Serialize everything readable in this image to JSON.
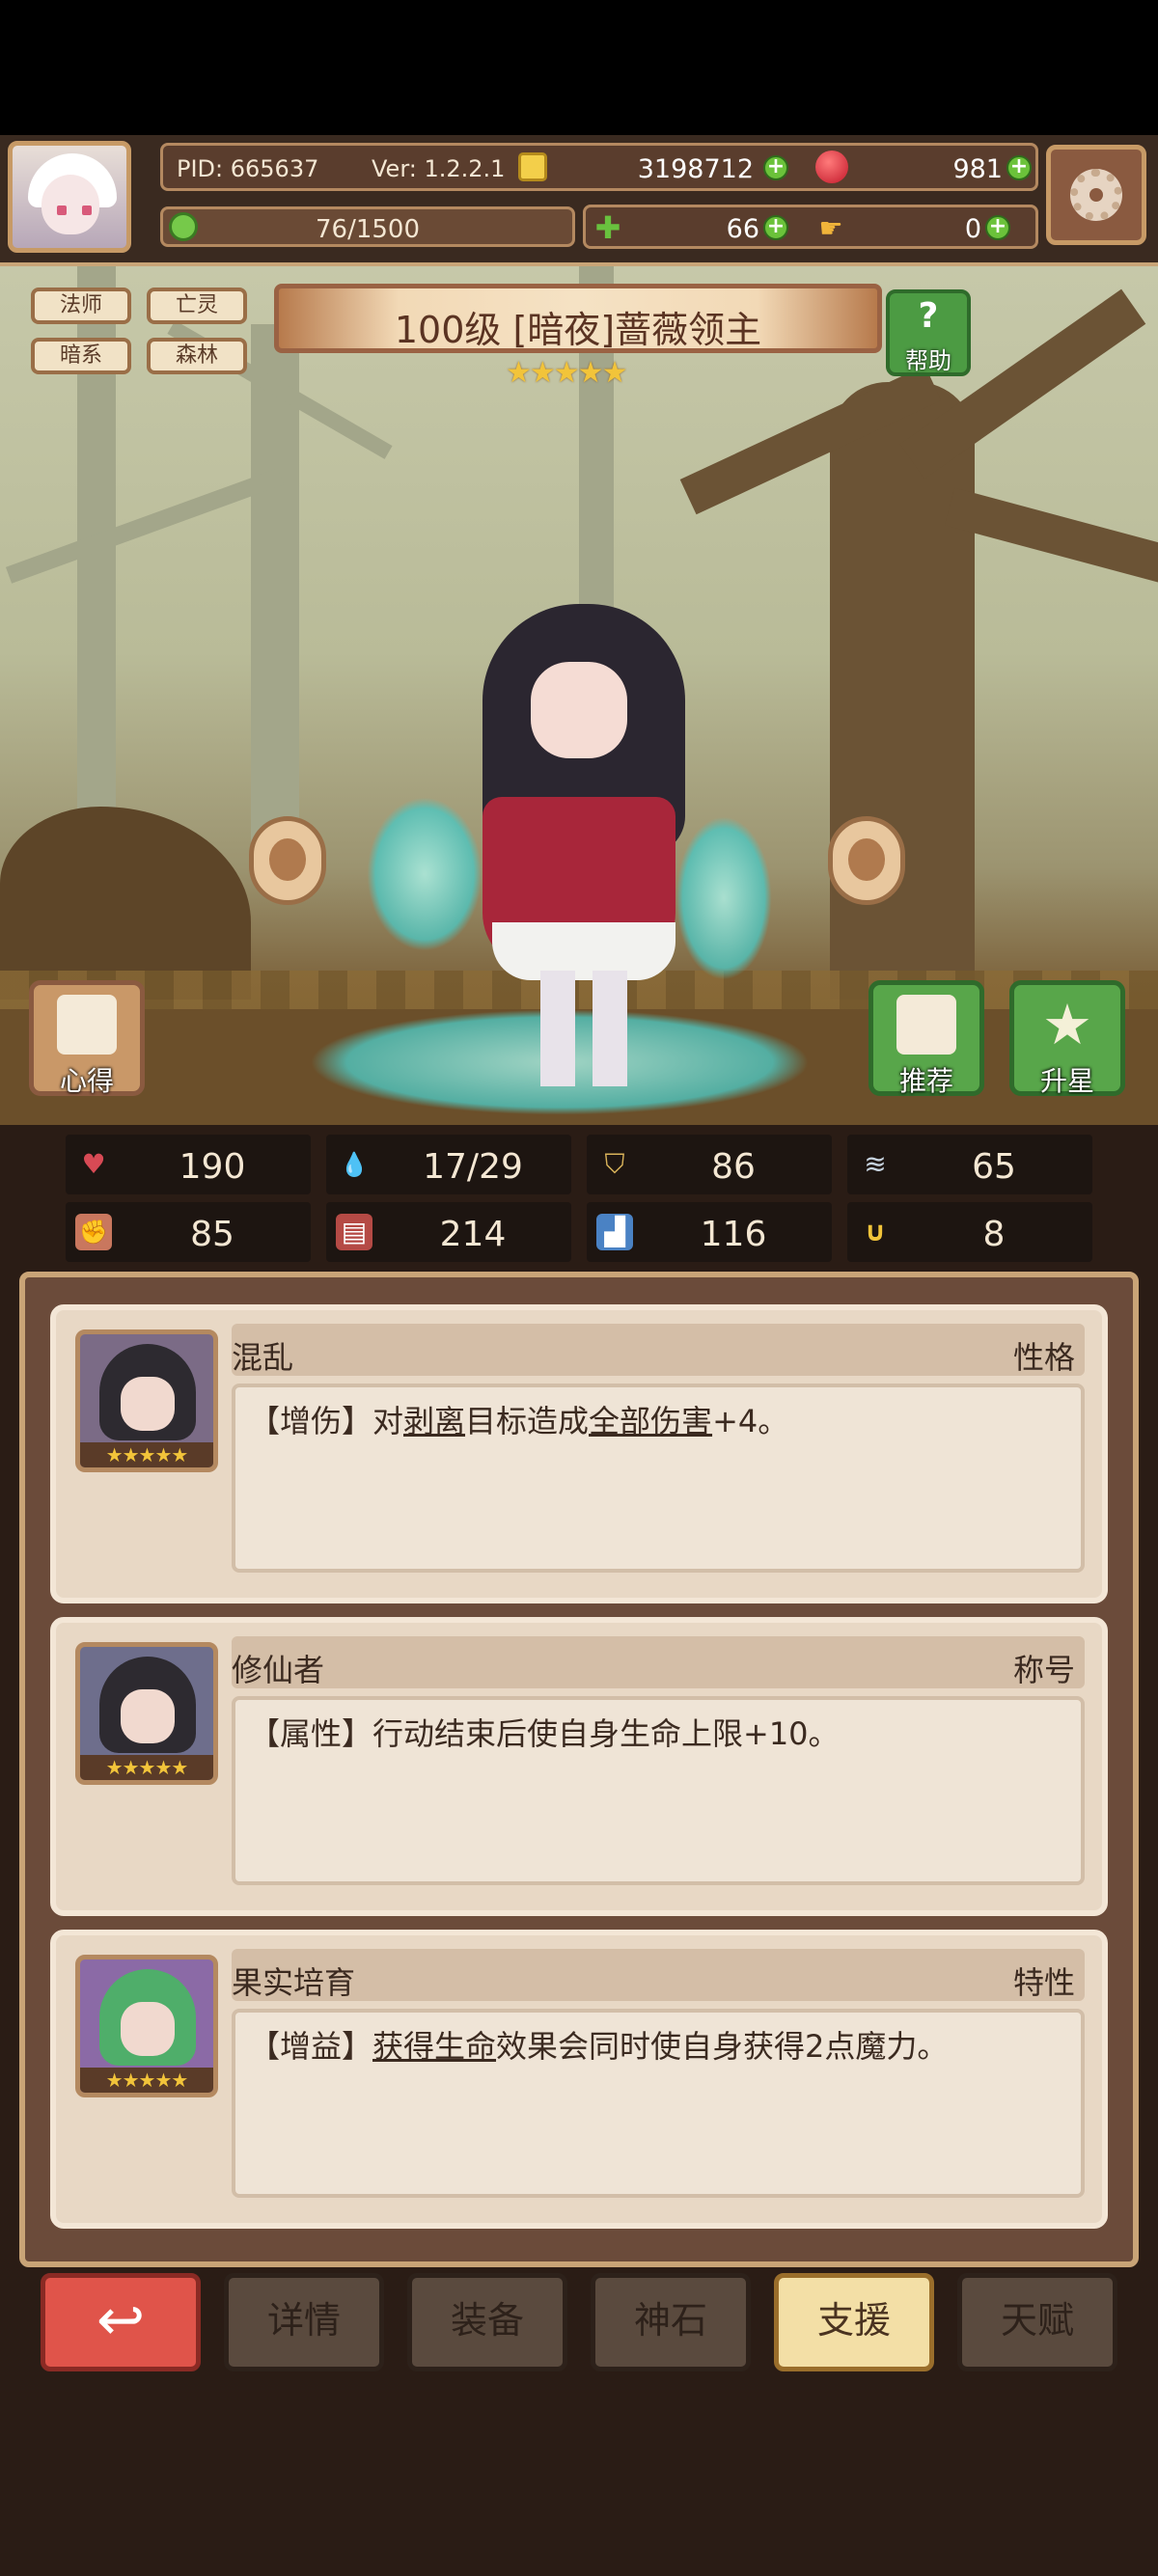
{
  "header": {
    "pid": "PID: 665637",
    "version": "Ver: 1.2.2.1",
    "gold": "3198712",
    "gems": "981",
    "exp": "76/1500",
    "clover": "66",
    "hands": "0",
    "plus_symbol": "+",
    "icons": [
      "portrait-avatar",
      "gold-coin-icon",
      "red-gem-icon",
      "exp-icon",
      "clover-icon",
      "hand-icon",
      "settings-gear-icon"
    ]
  },
  "tags": [
    "法师",
    "亡灵",
    "暗系",
    "森林"
  ],
  "character": {
    "title": "100级 [暗夜]蔷薇领主",
    "stars": "★★★★★",
    "help_label": "帮助",
    "help_symbol": "?",
    "heart_label": "心得",
    "recommend_label": "推荐",
    "starup_label": "升星",
    "starup_symbol": "★"
  },
  "stats": [
    {
      "icon": "heart-icon",
      "symbol": "♥",
      "value": "190",
      "color": "#d84a55"
    },
    {
      "icon": "water-drop-icon",
      "symbol": "💧",
      "value": "17/29",
      "color": "#3a8fd0"
    },
    {
      "icon": "shield-icon",
      "symbol": "⛉",
      "value": "86",
      "color": "#d9b35a"
    },
    {
      "icon": "wing-icon",
      "symbol": "≋",
      "value": "65",
      "color": "#8aa0b4"
    },
    {
      "icon": "fist-icon",
      "symbol": "✊",
      "value": "85",
      "color": "#c9775e"
    },
    {
      "icon": "book-icon",
      "symbol": "▤",
      "value": "214",
      "color": "#b54a45"
    },
    {
      "icon": "boot-icon",
      "symbol": "▟",
      "value": "116",
      "color": "#4a82c4"
    },
    {
      "icon": "magnet-icon",
      "symbol": "∪",
      "value": "8",
      "color": "#f2c43a"
    }
  ],
  "traits": [
    {
      "name": "混乱",
      "type": "性格",
      "text_pre": "【增伤】对",
      "text_u1": "剥离",
      "text_mid": "目标造成",
      "text_u2": "全部伤害",
      "text_post": "+4。",
      "stars": "★★★★★"
    },
    {
      "name": "修仙者",
      "type": "称号",
      "text_pre": "【属性】行动结束后使自身生命上限+10。",
      "text_u1": "",
      "text_mid": "",
      "text_u2": "",
      "text_post": "",
      "stars": "★★★★★"
    },
    {
      "name": "果实培育",
      "type": "特性",
      "text_pre": "【增益】",
      "text_u1": "获得生命",
      "text_mid": "效果会同时使自身获得2点魔力。",
      "text_u2": "",
      "text_post": "",
      "stars": "★★★★★"
    }
  ],
  "nav": {
    "back_symbol": "↩",
    "tabs": [
      "详情",
      "装备",
      "神石",
      "支援",
      "天赋"
    ],
    "active": "支援"
  }
}
